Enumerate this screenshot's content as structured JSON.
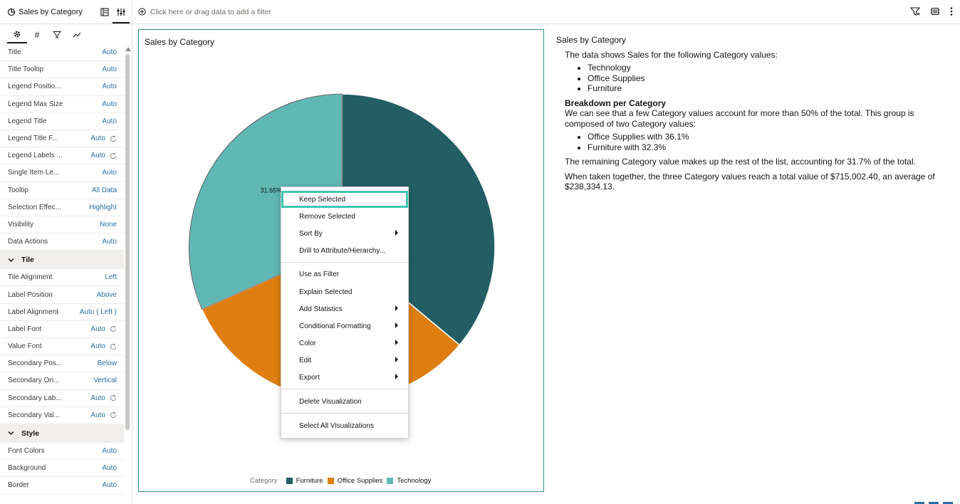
{
  "panel": {
    "title": "Sales by Category",
    "tabs": [
      "general-icon",
      "values-icon",
      "filter-icon",
      "analytics-icon"
    ]
  },
  "properties": [
    {
      "label": "Title",
      "value": "Auto",
      "reset": false
    },
    {
      "label": "Title Tooltip",
      "value": "Auto",
      "reset": false
    },
    {
      "label": "Legend Positio...",
      "value": "Auto",
      "reset": false
    },
    {
      "label": "Legend Max Size",
      "value": "Auto",
      "reset": false
    },
    {
      "label": "Legend Title",
      "value": "Auto",
      "reset": false
    },
    {
      "label": "Legend Title F...",
      "value": "Auto",
      "reset": true
    },
    {
      "label": "Legend Labels ...",
      "value": "Auto",
      "reset": true
    },
    {
      "label": "Single Item Le...",
      "value": "Auto",
      "reset": false
    },
    {
      "label": "Tooltip",
      "value": "All Data",
      "reset": false
    },
    {
      "label": "Selection Effec...",
      "value": "Highlight",
      "reset": false
    },
    {
      "label": "Visibility",
      "value": "None",
      "reset": false
    },
    {
      "label": "Data Actions",
      "value": "Auto",
      "reset": false
    }
  ],
  "tile_section": {
    "title": "Tile",
    "rows": [
      {
        "label": "Tile Alignment",
        "value": "Left",
        "reset": false
      },
      {
        "label": "Label Position",
        "value": "Above",
        "reset": false
      },
      {
        "label": "Label Alignment",
        "value": "Auto ( Left )",
        "reset": false
      },
      {
        "label": "Label Font",
        "value": "Auto",
        "reset": true
      },
      {
        "label": "Value Font",
        "value": "Auto",
        "reset": true
      },
      {
        "label": "Secondary Pos...",
        "value": "Below",
        "reset": false
      },
      {
        "label": "Secondary Ori...",
        "value": "Vertical",
        "reset": false
      },
      {
        "label": "Secondary Lab...",
        "value": "Auto",
        "reset": true
      },
      {
        "label": "Secondary Val...",
        "value": "Auto",
        "reset": true
      }
    ]
  },
  "style_section": {
    "title": "Style",
    "rows": [
      {
        "label": "Font Colors",
        "value": "Auto",
        "reset": false
      },
      {
        "label": "Background",
        "value": "Auto",
        "reset": false
      },
      {
        "label": "Border",
        "value": "Auto",
        "reset": false
      }
    ]
  },
  "filterbar": {
    "placeholder": "Click here or drag data to add a filter"
  },
  "viz": {
    "title": "Sales by Category",
    "legend_title": "Category"
  },
  "chart_data": {
    "type": "pie",
    "categories": [
      "Technology",
      "Furniture",
      "Office Supplies"
    ],
    "values": [
      36.05,
      32.3,
      31.65
    ],
    "data_labels": {
      "Furniture": "32.3%",
      "Office Supplies": "31.65%"
    },
    "colors": {
      "Technology": "#225e64",
      "Furniture": "#de7e11",
      "Office Supplies": "#60b8b5"
    },
    "legend": [
      {
        "name": "Furniture",
        "color": "#225e64"
      },
      {
        "name": "Office Supplies",
        "color": "#de7e11"
      },
      {
        "name": "Technology",
        "color": "#60b8b5"
      }
    ]
  },
  "narrative": {
    "title": "Sales by Category",
    "intro": "The data shows Sales for the following Category values:",
    "values": [
      "Technology",
      "Office Supplies",
      "Furniture"
    ],
    "breakdown_title": "Breakdown per Category",
    "breakdown_text": "We can see that a few Category values account for more than 50% of the total. This group is composed of two Category values:",
    "breakdown_items": [
      "Office Supplies with 36.1%",
      "Furniture with 32.3%"
    ],
    "remaining": "The remaining Category value makes up the rest of the list, accounting for 31.7% of the total.",
    "together": "When taken together, the three Category values reach a total value of $715,002.40, an average of $238,334.13."
  },
  "menu": {
    "items": [
      {
        "label": "Keep Selected",
        "submenu": false
      },
      {
        "label": "Remove Selected",
        "submenu": false
      },
      {
        "label": "Sort By",
        "submenu": true
      },
      {
        "label": "Drill to Attribute/Hierarchy...",
        "submenu": false
      },
      {
        "label": "Use as Filter",
        "submenu": false
      },
      {
        "label": "Explain Selected",
        "submenu": false
      },
      {
        "label": "Add Statistics",
        "submenu": true
      },
      {
        "label": "Conditional Formatting",
        "submenu": true
      },
      {
        "label": "Color",
        "submenu": true
      },
      {
        "label": "Edit",
        "submenu": true
      },
      {
        "label": "Export",
        "submenu": true
      },
      {
        "label": "Delete Visualization",
        "submenu": false
      },
      {
        "label": "Select All Visualizations",
        "submenu": false
      }
    ]
  },
  "colors": {
    "accent": "#2a6fa3",
    "focus": "#3ec6b3",
    "border": "#2f8b8a"
  }
}
